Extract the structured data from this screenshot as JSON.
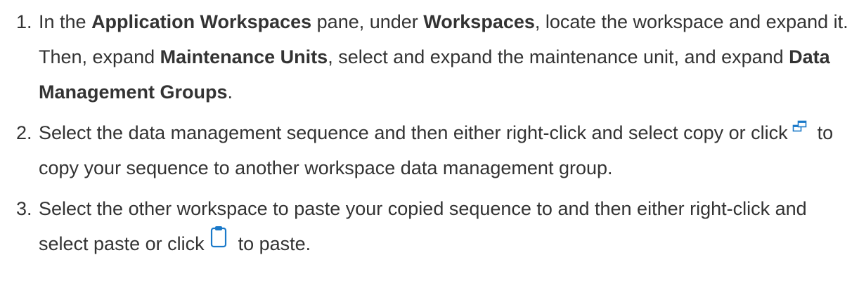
{
  "steps": [
    {
      "number": "1.",
      "parts": [
        "In the ",
        "Application Workspaces",
        " pane, under ",
        "Workspaces",
        ", locate the workspace and expand it. Then, expand ",
        "Maintenance Units",
        ", select and expand the maintenance unit, and expand ",
        "Data Management Groups",
        "."
      ]
    },
    {
      "number": "2.",
      "parts": [
        "Select the data management sequence and then either right-click and select copy or click",
        "to copy your sequence to another workspace data management group."
      ],
      "icon": "copy-icon"
    },
    {
      "number": "3.",
      "parts": [
        "Select the other workspace to paste your copied sequence to and then either right-click and select paste or click",
        "to paste."
      ],
      "icon": "paste-icon"
    }
  ],
  "colors": {
    "text": "#333333",
    "icon_blue": "#1a79c9"
  }
}
